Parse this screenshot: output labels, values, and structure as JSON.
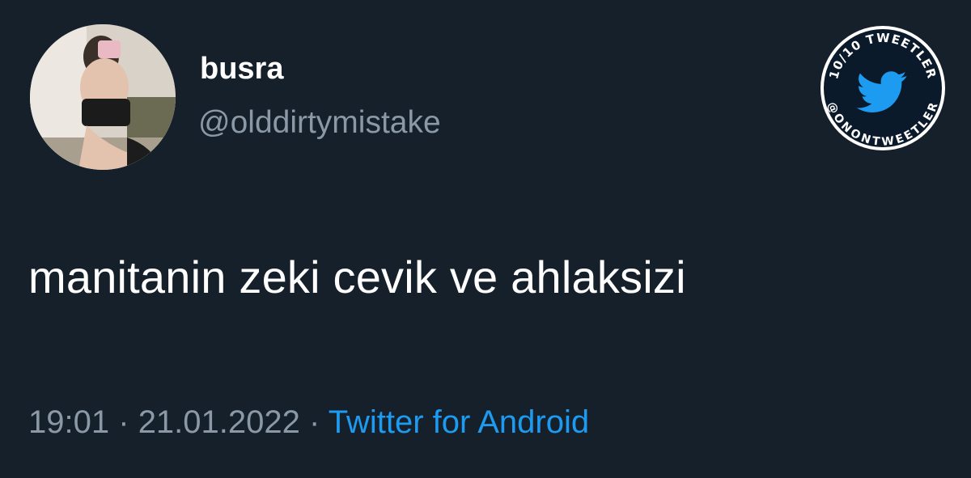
{
  "tweet": {
    "display_name": "busra",
    "handle": "@olddirtymistake",
    "text": "manitanin zeki cevik ve ahlaksizi",
    "time": "19:01",
    "separator": "·",
    "date": "21.01.2022",
    "source": "Twitter for Android"
  },
  "badge": {
    "top_text": "10/10 TWEETLER",
    "bottom_text": "@ONONTWEETLER",
    "icon": "twitter-bird-icon"
  },
  "colors": {
    "background": "#15202b",
    "primary_text": "#ffffff",
    "secondary_text": "#8b98a5",
    "accent": "#1d9bf0"
  }
}
